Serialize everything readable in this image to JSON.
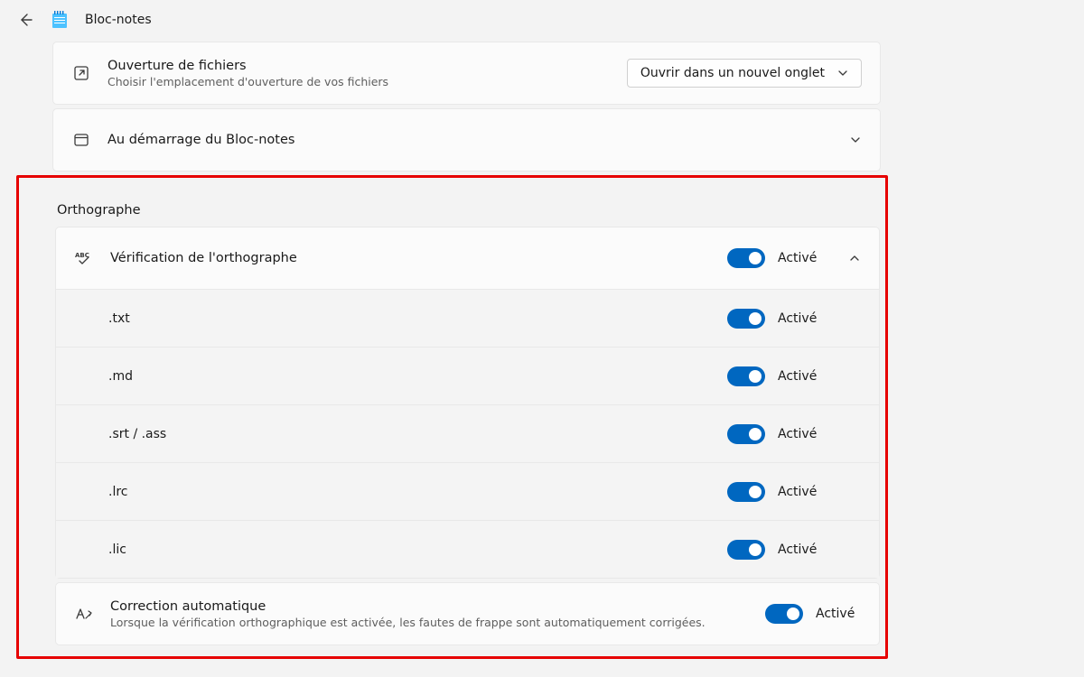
{
  "header": {
    "app_title": "Bloc-notes"
  },
  "file_opening": {
    "title": "Ouverture de fichiers",
    "subtitle": "Choisir l'emplacement d'ouverture de vos fichiers",
    "dropdown_value": "Ouvrir dans un nouvel onglet"
  },
  "startup": {
    "title": "Au démarrage du Bloc-notes"
  },
  "spelling": {
    "section_title": "Orthographe",
    "check": {
      "title": "Vérification de l'orthographe",
      "state_label": "Activé",
      "extensions": [
        {
          "label": ".txt",
          "state_label": "Activé"
        },
        {
          "label": ".md",
          "state_label": "Activé"
        },
        {
          "label": ".srt / .ass",
          "state_label": "Activé"
        },
        {
          "label": ".lrc",
          "state_label": "Activé"
        },
        {
          "label": ".lic",
          "state_label": "Activé"
        }
      ]
    },
    "autocorrect": {
      "title": "Correction automatique",
      "subtitle": "Lorsque la vérification orthographique est activée, les fautes de frappe sont automatiquement corrigées.",
      "state_label": "Activé"
    }
  }
}
